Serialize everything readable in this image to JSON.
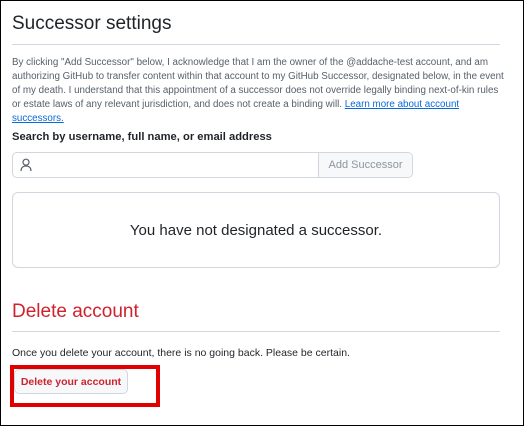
{
  "successor": {
    "title": "Successor settings",
    "description_text": "By clicking \"Add Successor\" below, I acknowledge that I am the owner of the @addache-test account, and am authorizing GitHub to transfer content within that account to my GitHub Successor, designated below, in the event of my death. I understand that this appointment of a successor does not override legally binding next-of-kin rules or estate laws of any relevant jurisdiction, and does not create a binding will.",
    "learn_more_link": "Learn more about account successors.",
    "search_label": "Search by username, full name, or email address",
    "search_value": "",
    "search_icon": "person-icon",
    "add_button": "Add Successor",
    "empty_message": "You have not designated a successor."
  },
  "delete": {
    "title": "Delete account",
    "description": "Once you delete your account, there is no going back. Please be certain.",
    "button_label": "Delete your account"
  },
  "colors": {
    "danger": "#cf222e",
    "link": "#0969da",
    "highlight": "#e00000",
    "border": "#d0d7de"
  }
}
